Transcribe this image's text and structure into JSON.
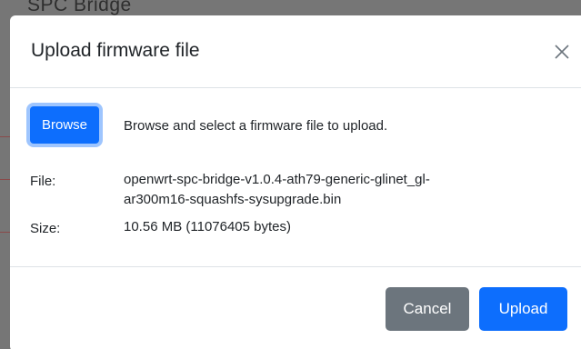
{
  "background": {
    "title_fragment": "SPC Bridge"
  },
  "modal": {
    "title": "Upload firmware file",
    "browse_label": "Browse",
    "browse_hint": "Browse and select a firmware file to upload.",
    "file_label": "File:",
    "file_value_line1": "openwrt-spc-bridge-v1.0.4-ath79-generic-glinet_gl-",
    "file_value_line2": "ar300m16-squashfs-sysupgrade.bin",
    "size_label": "Size:",
    "size_value": "10.56 MB (11076405 bytes)",
    "cancel_label": "Cancel",
    "upload_label": "Upload"
  },
  "colors": {
    "primary": "#0d6efd",
    "secondary": "#6c757d",
    "backdrop": "#767676"
  },
  "icons": {
    "close": "close-icon"
  }
}
